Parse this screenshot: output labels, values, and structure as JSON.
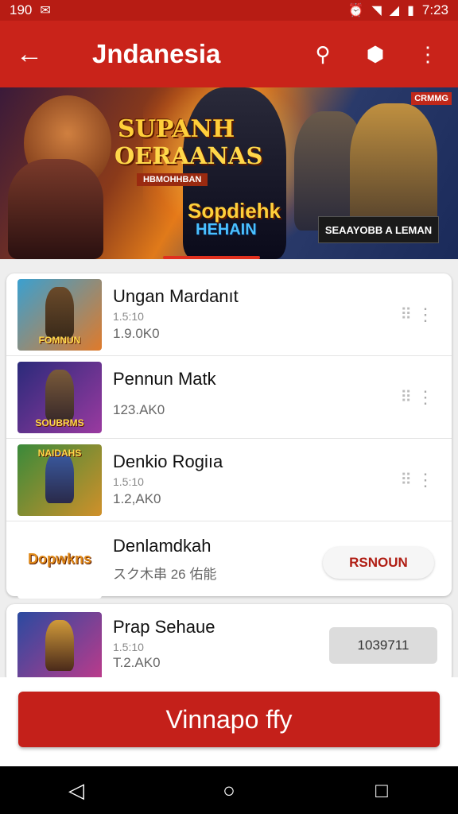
{
  "status_bar": {
    "left_text": "190",
    "left_icon": "notification-icon",
    "time": "7:23",
    "icons": [
      "alarm-icon",
      "wifi-icon",
      "signal-icon",
      "battery-icon"
    ]
  },
  "app_bar": {
    "title": "Jndanesia",
    "back_icon": "←",
    "search_icon": "⚲",
    "shield_icon": "⬢",
    "more_icon": "⋮"
  },
  "banner": {
    "title_line1": "SUPANH",
    "title_line2": "OERAANAS",
    "subtitle": "HBMOHHBAN",
    "subtitle2": "Sopdiehk",
    "subtitle3": "HEHAIN",
    "badge": "CRMMG",
    "cta_label": "SEAAYOBB A LEMAN"
  },
  "list": [
    {
      "name": "Ungan Mardanıt",
      "sub": "1.5:10",
      "meta": "1.9.0K0",
      "thumb_label": "FOMNUN"
    },
    {
      "name": "Pennun Matk",
      "sub": "",
      "meta": "123.AK0",
      "thumb_label": "SOUBRMS"
    },
    {
      "name": "Denkio Rogiıa",
      "sub": "1.5:10",
      "meta": "1.2,AK0",
      "thumb_label": "NAIDAHS"
    },
    {
      "name": "Denlamdkah",
      "sub": "",
      "meta": "スク木串 26 佑能",
      "thumb_label": "Dopwkns",
      "button": "RSNOUN"
    }
  ],
  "partial_item": {
    "name": "Prap Sehaue",
    "sub": "1.5:10",
    "meta": "T.2.AK0",
    "button": "1039711"
  },
  "main_button": "Vinnapo ffy",
  "nav": {
    "back": "◁",
    "home": "○",
    "recents": "□"
  }
}
